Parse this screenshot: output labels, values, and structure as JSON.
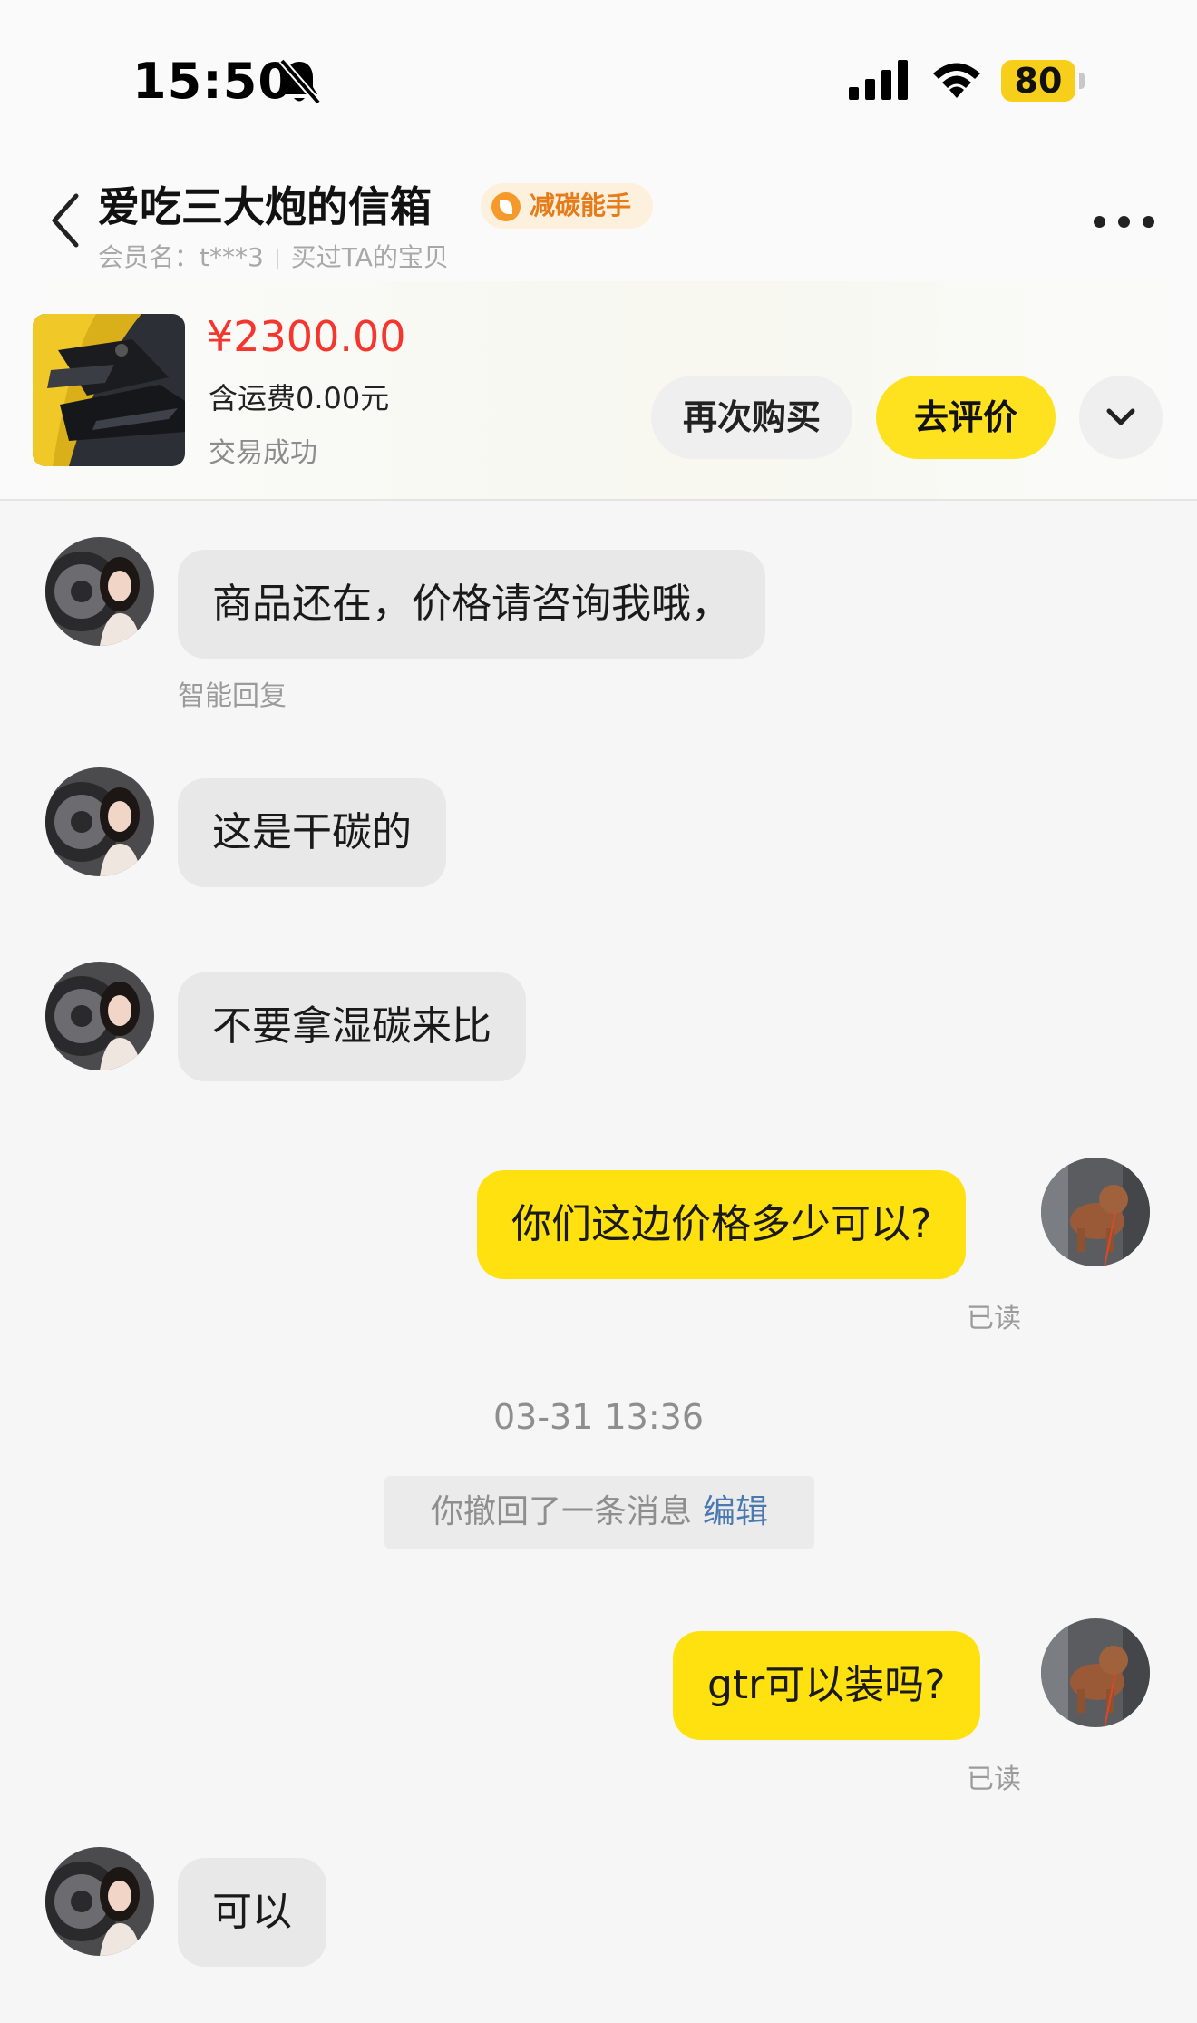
{
  "status_bar": {
    "time": "15:50",
    "battery": "80",
    "icons": [
      "bell-slash-icon",
      "signal-icon",
      "wifi-icon",
      "battery-icon"
    ]
  },
  "header": {
    "title": "爱吃三大炮的信箱",
    "badge": "减碳能手",
    "member": "会员名：t***3",
    "bought": "买过TA的宝贝",
    "icons": [
      "back-icon",
      "more-icon"
    ]
  },
  "product": {
    "price": "¥2300.00",
    "shipping": "含运费0.00元",
    "status": "交易成功",
    "rebuy_label": "再次购买",
    "review_label": "去评价"
  },
  "messages": [
    {
      "from": "seller",
      "text": "商品还在，价格请咨询我哦，",
      "note": "智能回复"
    },
    {
      "from": "seller",
      "text": "这是干碳的"
    },
    {
      "from": "seller",
      "text": "不要拿湿碳来比"
    },
    {
      "from": "me",
      "text": "你们这边价格多少可以?",
      "note": "已读"
    },
    {
      "from": "system",
      "timestamp": "03-31 13:36",
      "recall_text": "你撤回了一条消息",
      "recall_action": "编辑"
    },
    {
      "from": "me",
      "text": "gtr可以装吗?",
      "note": "已读"
    },
    {
      "from": "seller",
      "text": "可以"
    }
  ],
  "colors": {
    "accent_yellow": "#ffe10f",
    "price_red": "#f5362e",
    "badge_orange": "#e67b1a",
    "link_blue": "#4a78b0"
  }
}
